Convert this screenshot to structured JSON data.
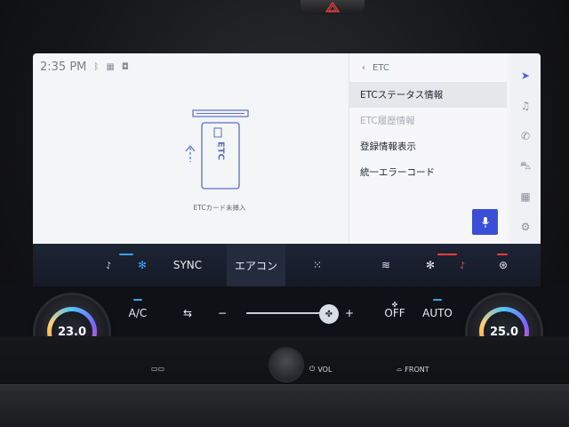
{
  "status": {
    "time": "2:35 PM"
  },
  "card": {
    "brand": "ETC",
    "caption": "ETCカード未挿入"
  },
  "menu": {
    "back_label": "ETC",
    "items": [
      {
        "label": "ETCステータス情報",
        "state": "selected"
      },
      {
        "label": "ETC履歴情報",
        "state": "disabled"
      },
      {
        "label": "登録情報表示",
        "state": "normal"
      },
      {
        "label": "統一エラーコード",
        "state": "normal"
      }
    ]
  },
  "rail": {
    "icons": [
      "navigation-icon",
      "music-icon",
      "phone-icon",
      "car-icon",
      "apps-icon",
      "settings-icon"
    ]
  },
  "climate": {
    "sync_label": "SYNC",
    "aircon_label": "エアコン",
    "ac_label": "A/C",
    "fan_minus": "−",
    "fan_plus": "+",
    "off_label": "OFF",
    "auto_label": "AUTO",
    "left_temp": "23.0",
    "right_temp": "25.0",
    "vol_label": "VOL",
    "front_label": "FRONT"
  },
  "colors": {
    "accent": "#3b4fd6",
    "indicator_blue": "#3aa0ff",
    "indicator_red": "#ff3b3b"
  }
}
